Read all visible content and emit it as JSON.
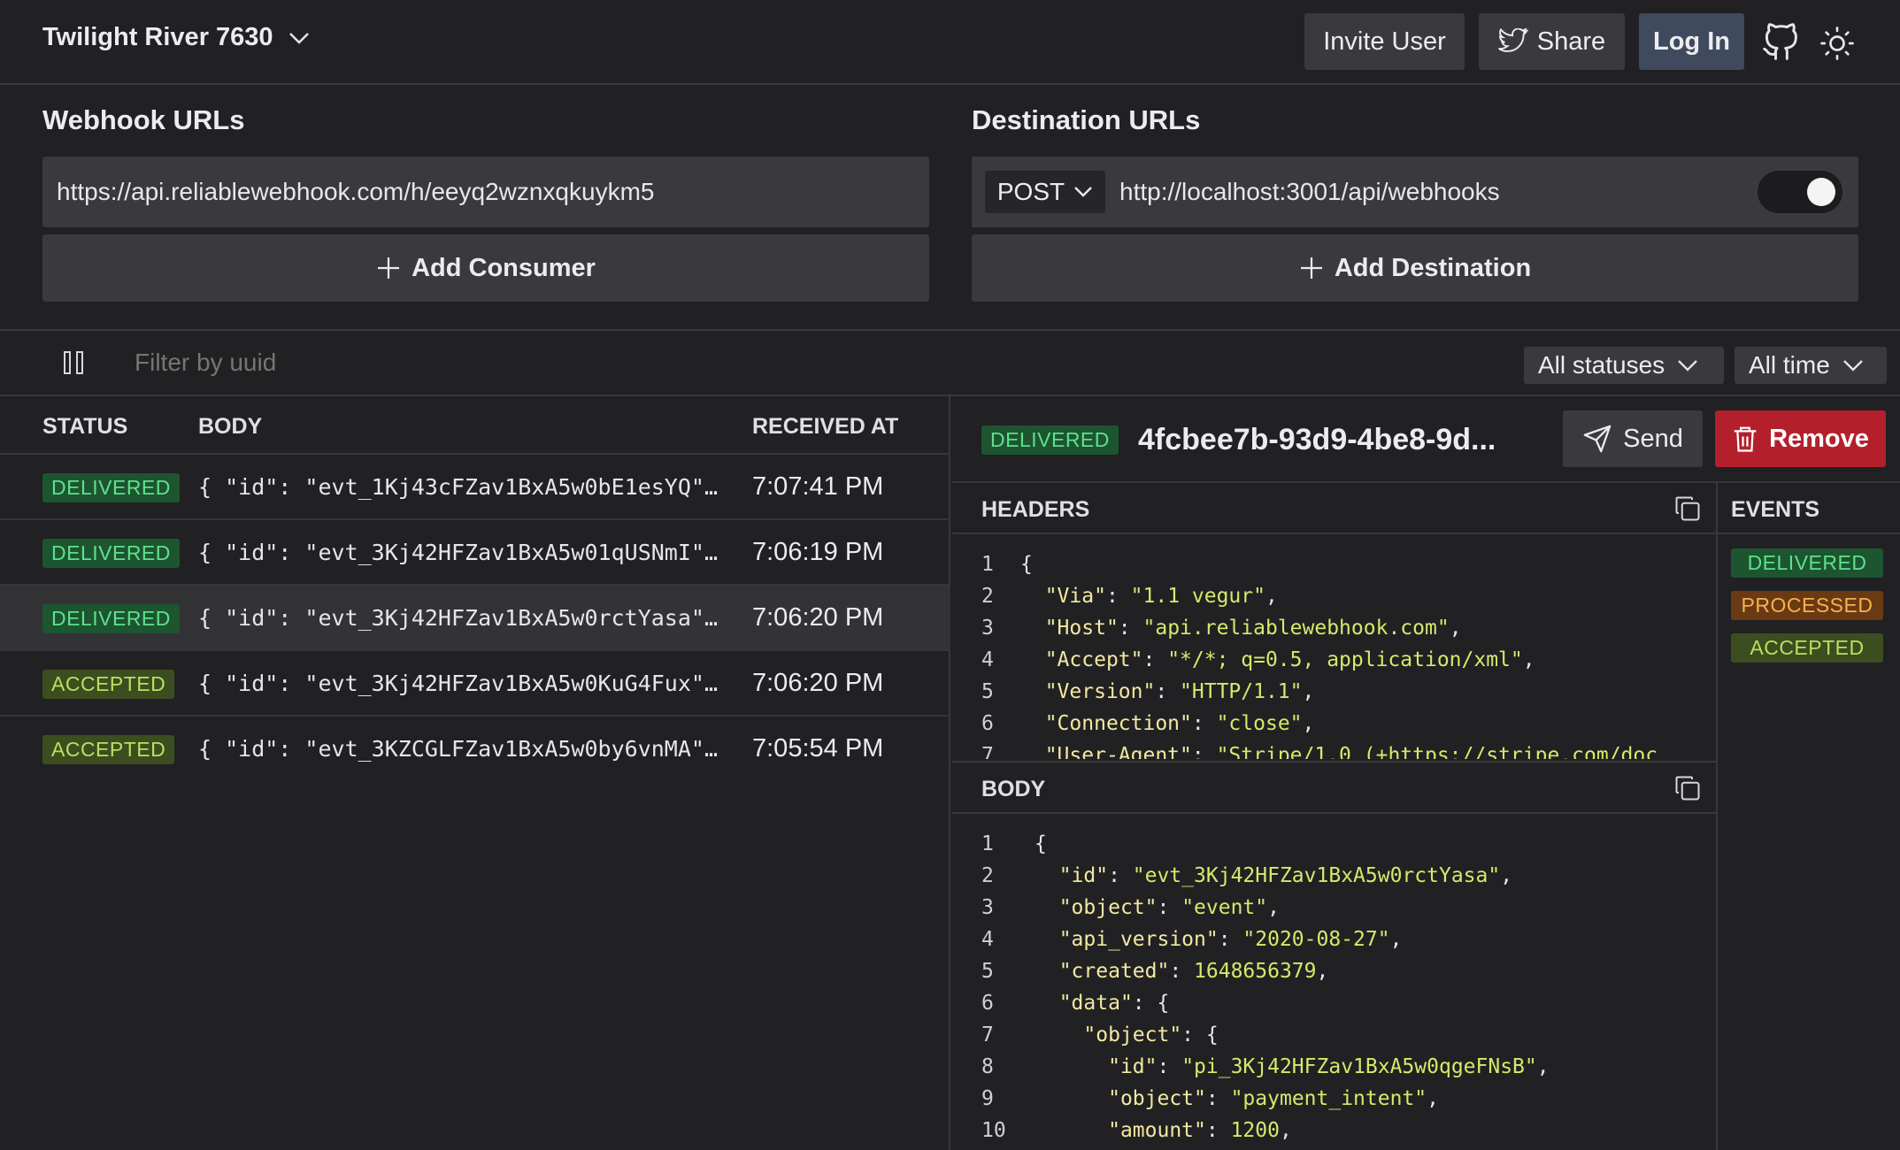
{
  "header": {
    "project_name": "Twilight River 7630",
    "invite_label": "Invite User",
    "share_label": "Share",
    "login_label": "Log In"
  },
  "webhooks": {
    "title": "Webhook URLs",
    "url": "https://api.reliablewebhook.com/h/eeyq2wznxqkuykm5",
    "add_label": "Add Consumer"
  },
  "destinations": {
    "title": "Destination URLs",
    "method": "POST",
    "url": "http://localhost:3001/api/webhooks",
    "enabled": true,
    "add_label": "Add Destination"
  },
  "filters": {
    "placeholder": "Filter by uuid",
    "status": "All statuses",
    "time": "All time"
  },
  "table": {
    "columns": [
      "STATUS",
      "BODY",
      "RECEIVED AT"
    ],
    "rows": [
      {
        "status": "DELIVERED",
        "body": "{ \"id\": \"evt_1Kj43cFZav1BxA5w0bE1esYQ\",…",
        "time": "7:07:41 PM"
      },
      {
        "status": "DELIVERED",
        "body": "{ \"id\": \"evt_3Kj42HFZav1BxA5w01qUSNmI\",…",
        "time": "7:06:19 PM"
      },
      {
        "status": "DELIVERED",
        "body": "{ \"id\": \"evt_3Kj42HFZav1BxA5w0rctYasa\",…",
        "time": "7:06:20 PM"
      },
      {
        "status": "ACCEPTED",
        "body": "{ \"id\": \"evt_3Kj42HFZav1BxA5w0KuG4Fux\",…",
        "time": "7:06:20 PM"
      },
      {
        "status": "ACCEPTED",
        "body": "{ \"id\": \"evt_3KZCGLFZav1BxA5w0by6vnMA\",…",
        "time": "7:05:54 PM"
      }
    ]
  },
  "detail": {
    "status": "DELIVERED",
    "uuid": "4fcbee7b-93d9-4be8-9d...",
    "send_label": "Send",
    "remove_label": "Remove",
    "headers_title": "HEADERS",
    "body_title": "BODY",
    "events_title": "EVENTS",
    "events": [
      "DELIVERED",
      "PROCESSED",
      "ACCEPTED"
    ],
    "header_lines": [
      {
        "n": "1",
        "text": "{"
      },
      {
        "n": "2",
        "key": "\"Via\"",
        "val": "\"1.1 vegur\""
      },
      {
        "n": "3",
        "key": "\"Host\"",
        "val": "\"api.reliablewebhook.com\""
      },
      {
        "n": "4",
        "key": "\"Accept\"",
        "val": "\"*/*; q=0.5, application/xml\""
      },
      {
        "n": "5",
        "key": "\"Version\"",
        "val": "\"HTTP/1.1\""
      },
      {
        "n": "6",
        "key": "\"Connection\"",
        "val": "\"close\""
      },
      {
        "n": "7",
        "key": "\"User-Agent\"",
        "val": "\"Stripe/1.0 (+https://stripe.com/doc"
      }
    ],
    "body_lines": [
      {
        "n": "1",
        "indent": 0,
        "text": "{"
      },
      {
        "n": "2",
        "indent": 1,
        "key": "\"id\"",
        "val": "\"evt_3Kj42HFZav1BxA5w0rctYasa\""
      },
      {
        "n": "3",
        "indent": 1,
        "key": "\"object\"",
        "val": "\"event\""
      },
      {
        "n": "4",
        "indent": 1,
        "key": "\"api_version\"",
        "val": "\"2020-08-27\""
      },
      {
        "n": "5",
        "indent": 1,
        "key": "\"created\"",
        "val": "1648656379"
      },
      {
        "n": "6",
        "indent": 1,
        "key": "\"data\"",
        "open": "{"
      },
      {
        "n": "7",
        "indent": 2,
        "key": "\"object\"",
        "open": "{"
      },
      {
        "n": "8",
        "indent": 3,
        "key": "\"id\"",
        "val": "\"pi_3Kj42HFZav1BxA5w0qgeFNsB\""
      },
      {
        "n": "9",
        "indent": 3,
        "key": "\"object\"",
        "val": "\"payment_intent\""
      },
      {
        "n": "10",
        "indent": 3,
        "key": "\"amount\"",
        "val": "1200"
      }
    ]
  }
}
